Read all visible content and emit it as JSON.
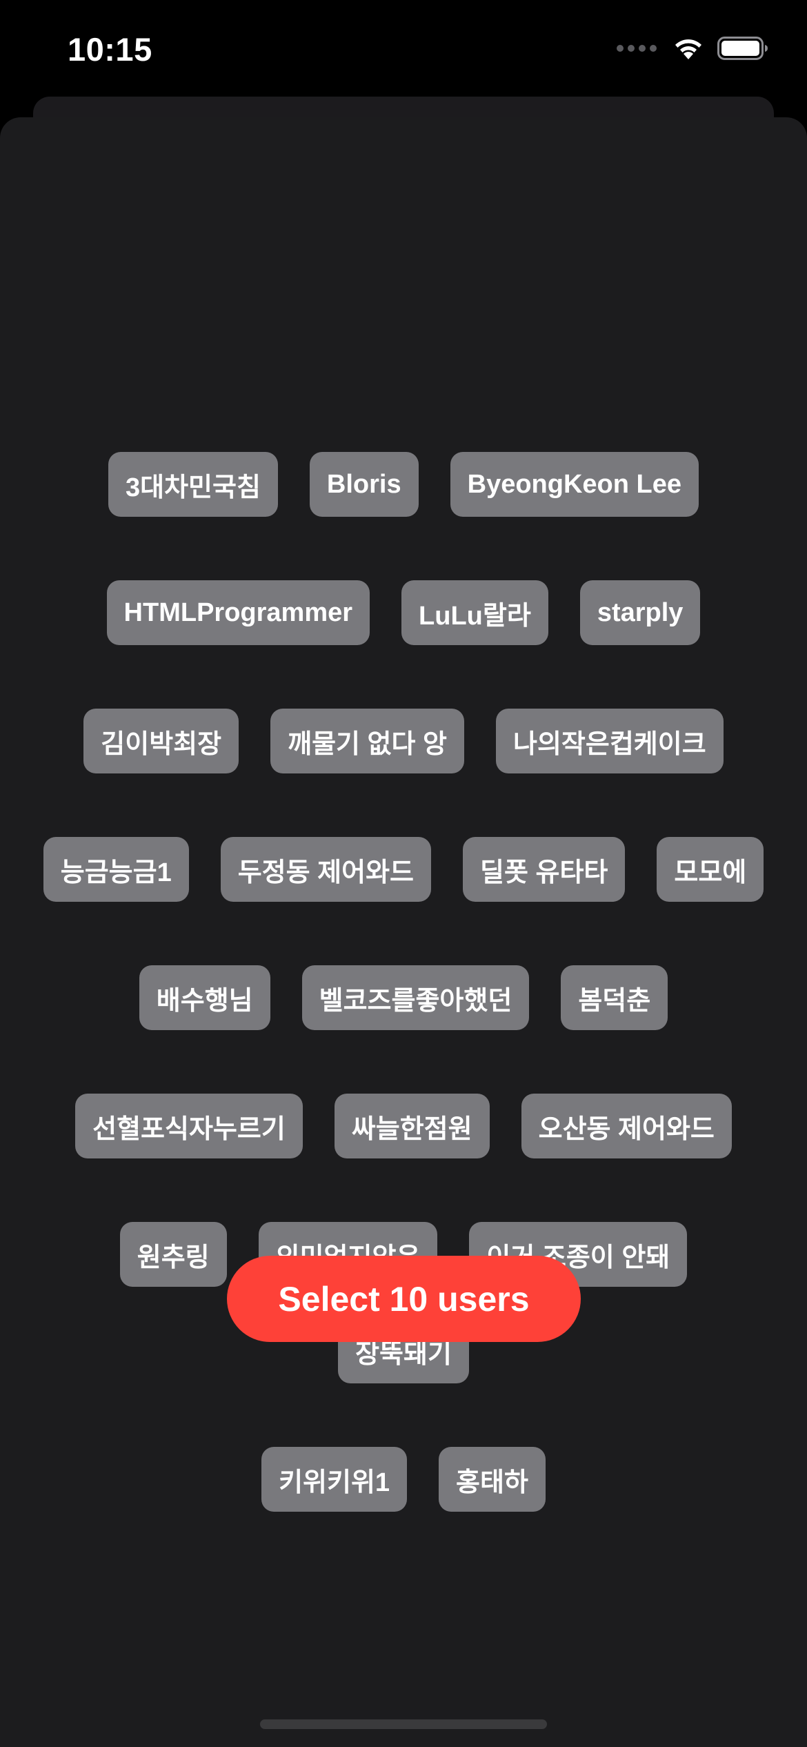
{
  "status_bar": {
    "time": "10:15",
    "icons": [
      "signal-dots-icon",
      "wifi-icon",
      "battery-icon"
    ]
  },
  "colors": {
    "background": "#000000",
    "sheet": "#1c1c1e",
    "chip": "#79797d",
    "accent": "#fe4138",
    "text": "#ffffff"
  },
  "users": [
    [
      "3대차민국침",
      "Bloris",
      "ByeongKeon Lee"
    ],
    [
      "HTMLProgrammer",
      "LuLu랄라",
      "starply"
    ],
    [
      "김이박최장",
      "깨물기 없다 앙",
      "나의작은컵케이크"
    ],
    [
      "능금능금1",
      "두정동 제어와드",
      "딜폿 유타타",
      "모모에"
    ],
    [
      "배수행님",
      "벨코즈를좋아했던",
      "봄덕춘"
    ],
    [
      "선혈포식자누르기",
      "싸늘한점원",
      "오산동 제어와드"
    ],
    [
      "원추링",
      "의미없지않은",
      "이거 조종이 안돼",
      "장뚝돼기"
    ],
    [
      "키위키위1",
      "홍태하"
    ]
  ],
  "select_button": {
    "label": "Select 10 users"
  }
}
